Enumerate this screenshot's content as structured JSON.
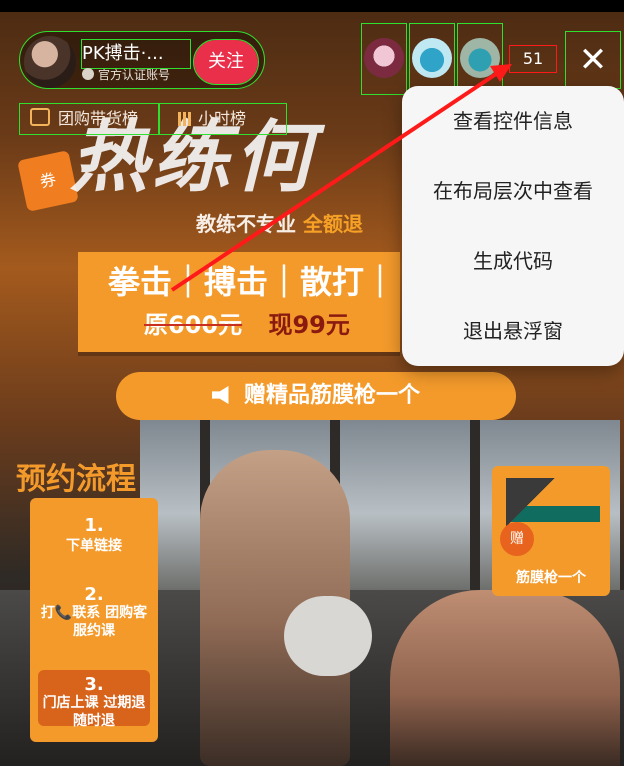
{
  "anchor": {
    "name": "PK搏击·...",
    "verified": "官方认证账号",
    "follow_label": "关注"
  },
  "tags": [
    {
      "label": "团购带货榜"
    },
    {
      "label": "小时榜"
    }
  ],
  "viewers": {
    "count": "51",
    "close_glyph": "✕"
  },
  "video": {
    "headline": "热练何",
    "ticket_label": "券",
    "sub_prefix": "教练不专业",
    "sub_highlight": "全额退",
    "banner_top": "拳击｜搏击｜散打｜",
    "banner_old_price": "原600元",
    "banner_new_price": "现99元",
    "gift": "赠精品筋膜枪一个",
    "flow_title": "预约流程",
    "steps": [
      {
        "num": "1.",
        "text": "下单链接"
      },
      {
        "num": "2.",
        "text": "打📞联系 团购客服约课"
      },
      {
        "num": "3.",
        "text": "门店上课 过期退随时退"
      }
    ],
    "gun_badge": "赠",
    "gun_label": "筋膜枪一个"
  },
  "context_menu": {
    "items": [
      {
        "label": "查看控件信息"
      },
      {
        "label": "在布局层次中查看"
      },
      {
        "label": "生成代码"
      },
      {
        "label": "退出悬浮窗"
      }
    ]
  },
  "colors": {
    "accent_orange": "#f39a2b",
    "follow_red": "#ea2f4b",
    "highlight_green": "#2fe02f",
    "highlight_red": "#ff1a1a"
  }
}
